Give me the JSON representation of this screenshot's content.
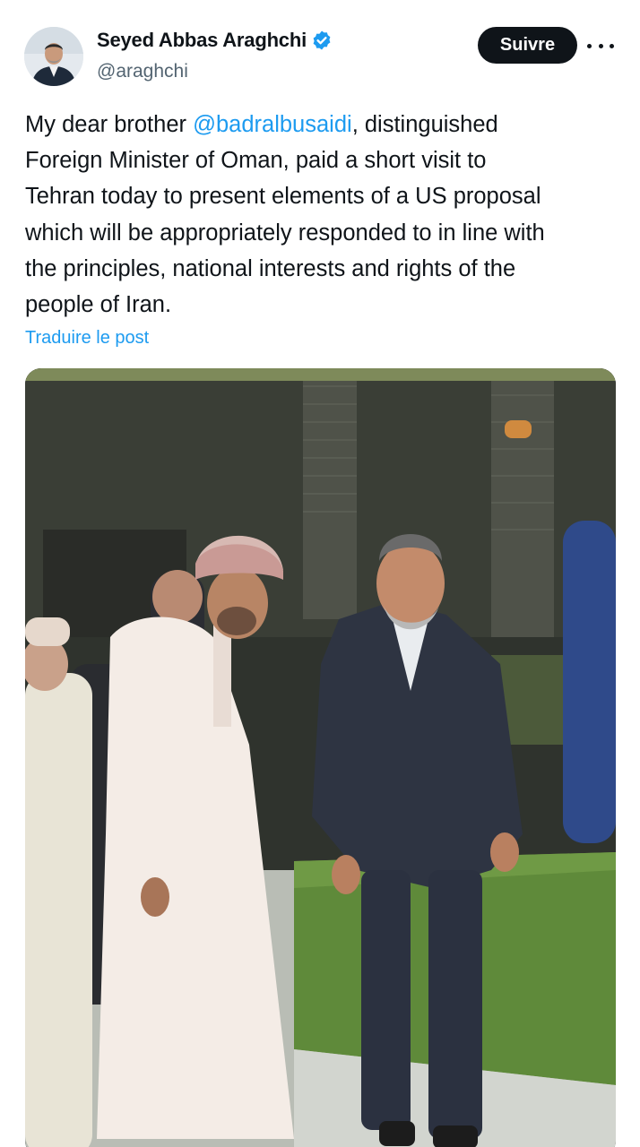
{
  "author": {
    "display_name": "Seyed Abbas Araghchi",
    "handle": "@araghchi",
    "verified_icon": "verified-badge-icon",
    "avatar_icon": "profile-avatar"
  },
  "actions": {
    "follow_label": "Suivre",
    "more_icon": "more-options-icon"
  },
  "tweet": {
    "text_before_mention": "My dear brother ",
    "mention": "@badralbusaidi",
    "text_after_mention": ", distinguished\nForeign Minister of Oman, paid a short visit to\nTehran today to present elements of a US proposal\nwhich will be appropriately responded to in line with\nthe principles, national interests and rights of the\npeople of Iran.",
    "translate_label": "Traduire le post"
  },
  "media": {
    "type": "photo"
  },
  "colors": {
    "accent": "#1d9bf0",
    "text": "#0f1419",
    "secondary_text": "#536471",
    "button_bg": "#0f1419"
  }
}
